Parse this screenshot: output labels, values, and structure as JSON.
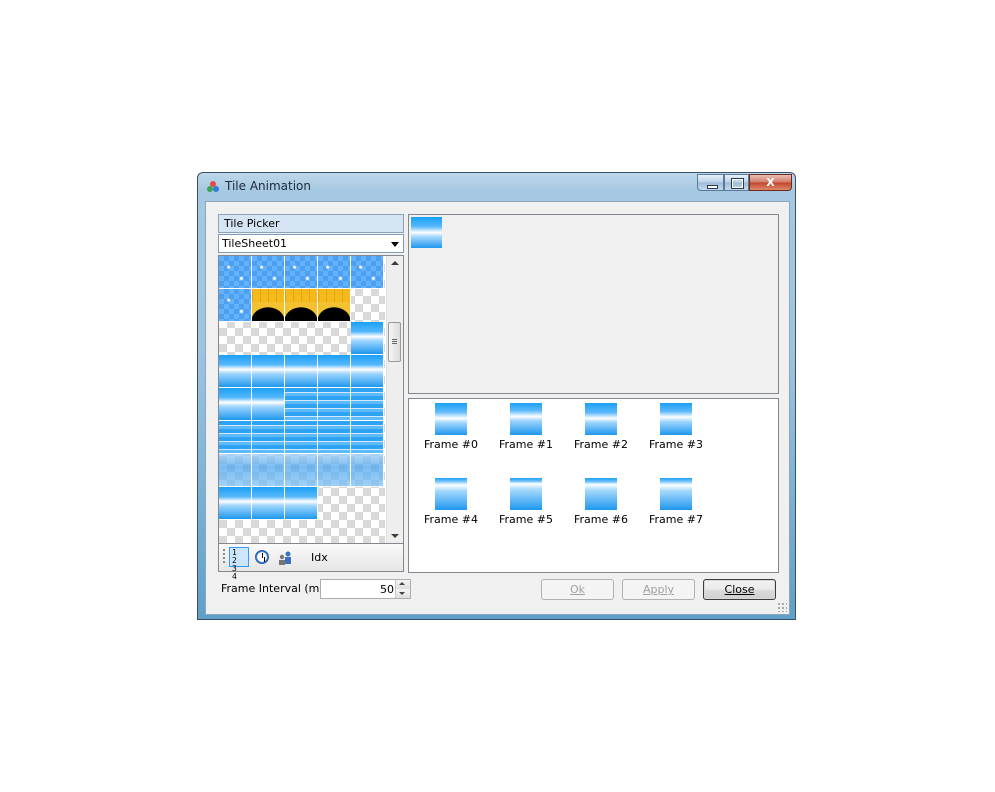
{
  "window": {
    "title": "Tile Animation",
    "controls": {
      "minimize": "minimize",
      "maximize": "maximize",
      "close": "X"
    }
  },
  "tile_picker": {
    "header": "Tile Picker",
    "tilesheet": "TileSheet01",
    "toolbar": {
      "idx_label": "Idx"
    }
  },
  "frame_interval": {
    "label": "Frame Interval (ms)",
    "value": "50"
  },
  "frames": [
    {
      "label": "Frame #0",
      "variant": "a"
    },
    {
      "label": "Frame #1",
      "variant": "b"
    },
    {
      "label": "Frame #2",
      "variant": "c"
    },
    {
      "label": "Frame #3",
      "variant": "d"
    },
    {
      "label": "Frame #4",
      "variant": "e"
    },
    {
      "label": "Frame #5",
      "variant": "f"
    },
    {
      "label": "Frame #6",
      "variant": "g"
    },
    {
      "label": "Frame #7",
      "variant": "h"
    }
  ],
  "buttons": {
    "ok": "Ok",
    "apply": "Apply",
    "close": "Close"
  },
  "colors": {
    "water_light": "#ffffff",
    "water_dark": "#1aa0f6",
    "arch_yellow": "#f5b91c"
  }
}
